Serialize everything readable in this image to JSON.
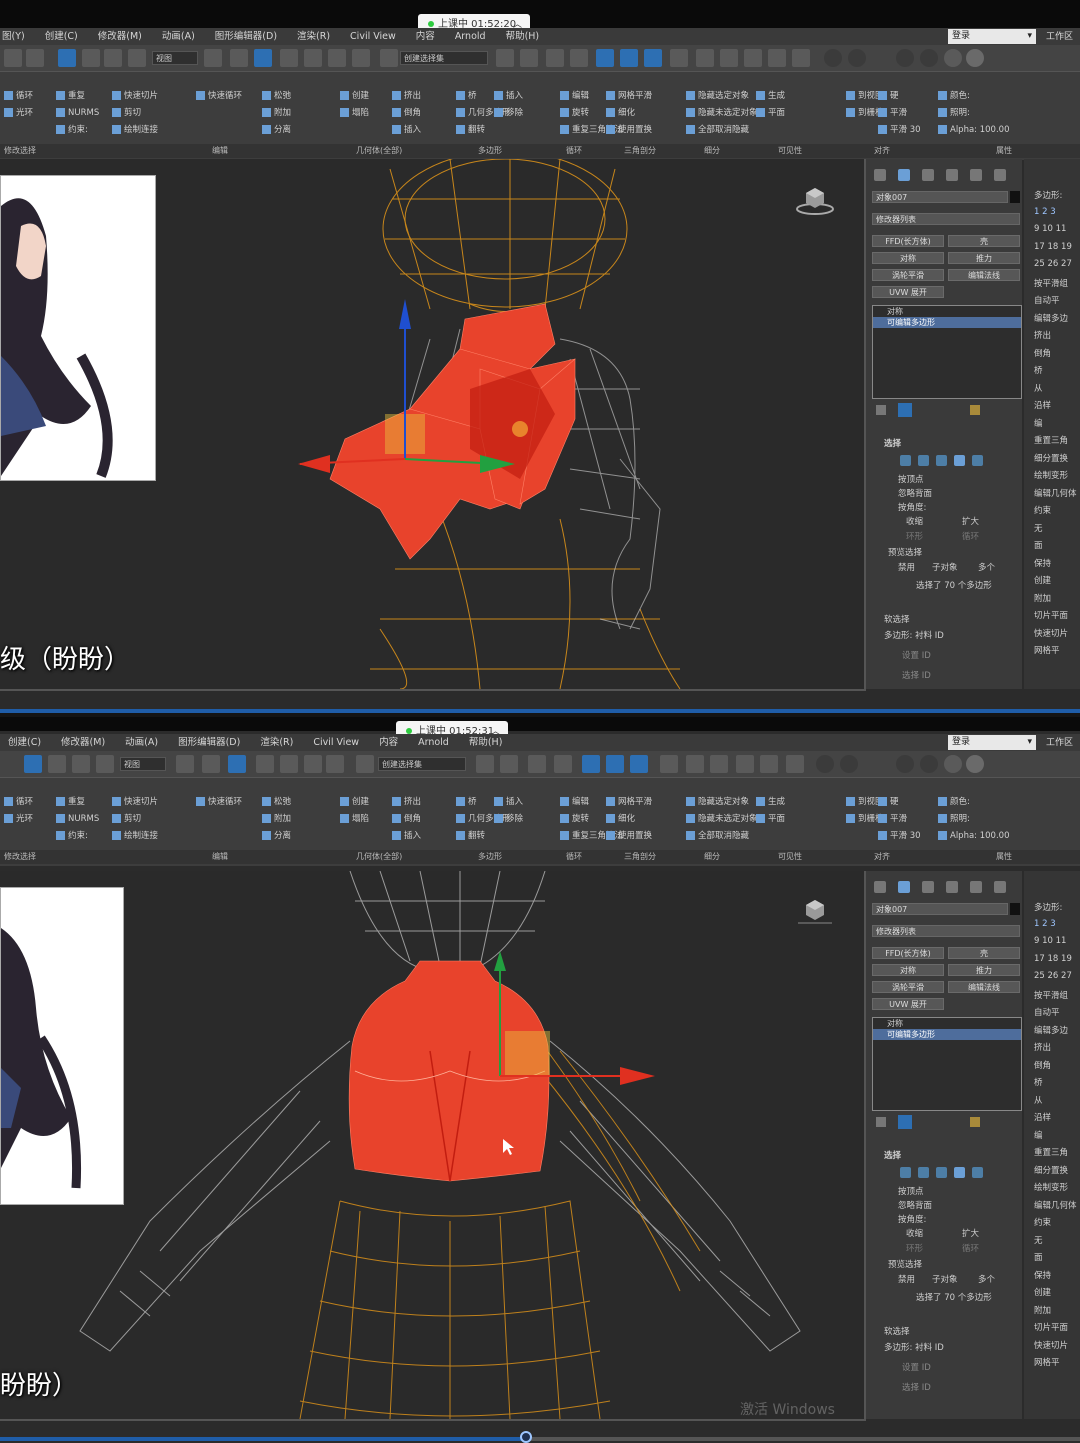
{
  "panels": [
    {
      "id": "shot1",
      "live_status": "上课中 01:52:20",
      "menu": [
        "图(Y)",
        "创建(C)",
        "修改器(M)",
        "动画(A)",
        "图形编辑器(D)",
        "渲染(R)",
        "Civil View",
        "内容",
        "Arnold",
        "帮助(H)"
      ],
      "login": "登录",
      "workspace": "工作区",
      "toolbar": {
        "view_dropdown": "视图",
        "selection_set": "创建选择集"
      },
      "ribbon_groups": [
        {
          "items": [
            "循环",
            "光环"
          ]
        },
        {
          "items": [
            "重复",
            "NURMS",
            "约束:"
          ]
        },
        {
          "items": [
            "快速切片",
            "剪切",
            "绘制连接"
          ]
        },
        {
          "items": [
            "快速循环"
          ]
        },
        {
          "items": [
            "松弛",
            "附加",
            "分离"
          ]
        },
        {
          "items": [
            "创建",
            "塌陷"
          ]
        },
        {
          "items": [
            "挤出",
            "倒角",
            "插入"
          ]
        },
        {
          "items": [
            "桥",
            "几何多边形",
            "翻转"
          ]
        },
        {
          "items": [
            "插入",
            "移除"
          ]
        },
        {
          "items": [
            "编辑",
            "旋转",
            "重复三角算法"
          ]
        },
        {
          "items": [
            "网格平滑",
            "细化",
            "使用置换"
          ]
        },
        {
          "items": [
            "隐藏选定对象",
            "隐藏未选定对象",
            "全部取消隐藏"
          ]
        },
        {
          "items": [
            "生成",
            "平面"
          ]
        },
        {
          "items": [
            "到视图",
            "到栅格"
          ]
        },
        {
          "items": [
            "硬",
            "平滑",
            "平滑 30"
          ]
        },
        {
          "items": [
            "颜色:",
            "照明:",
            "Alpha: 100.00"
          ]
        }
      ],
      "ribbon_footer": [
        "修改选择",
        "编辑",
        "几何体(全部)",
        "多边形",
        "循环",
        "三角剖分",
        "细分",
        "可见性",
        "对齐",
        "属性"
      ],
      "subtitle": "级（盼盼）",
      "command_panel": {
        "object_name": "对象007",
        "modifier_list": "修改器列表",
        "buttons": [
          "FFD(长方体)",
          "壳",
          "对称",
          "推力",
          "涡轮平滑",
          "编辑法线",
          "UVW 展开"
        ],
        "stack": [
          "对称",
          "可编辑多边形"
        ],
        "selection_title": "选择",
        "options": [
          "按顶点",
          "忽略背面",
          "按角度:",
          "收缩",
          "扩大",
          "环形",
          "循环",
          "预览选择",
          "禁用",
          "子对象",
          "多个"
        ],
        "status": "选择了 70 个多边形",
        "soft_title": "软选择",
        "soft_items": [
          "多边形: 衬料 ID",
          "设置 ID",
          "选择 ID"
        ]
      },
      "side_panel": [
        "多边形:",
        "1 2 3",
        "9 10 11",
        "17 18 19",
        "25 26 27",
        "按平滑组",
        "自动平",
        "编辑多边",
        "挤出",
        "倒角",
        "桥",
        "从",
        "沿样",
        "编",
        "重置三角",
        "细分置换",
        "绘制变形",
        "编辑几何体",
        "约束",
        "无",
        "面",
        "保持",
        "创建",
        "附加",
        "切片平面",
        "快速切片",
        "网格平"
      ]
    },
    {
      "id": "shot2",
      "live_status": "上课中 01:52:31",
      "menu": [
        "创建(C)",
        "修改器(M)",
        "动画(A)",
        "图形编辑器(D)",
        "渲染(R)",
        "Civil View",
        "内容",
        "Arnold",
        "帮助(H)"
      ],
      "login": "登录",
      "workspace": "工作区",
      "toolbar": {
        "view_dropdown": "视图",
        "selection_set": "创建选择集"
      },
      "subtitle": "盼盼）",
      "watermark": "激活 Windows",
      "command_panel": {
        "object_name": "对象007",
        "modifier_list": "修改器列表",
        "buttons": [
          "FFD(长方体)",
          "壳",
          "对称",
          "推力",
          "涡轮平滑",
          "编辑法线",
          "UVW 展开"
        ],
        "stack": [
          "对称",
          "可编辑多边形"
        ],
        "selection_title": "选择",
        "options": [
          "按顶点",
          "忽略背面",
          "按角度:",
          "收缩",
          "扩大",
          "环形",
          "循环",
          "预览选择",
          "禁用",
          "子对象",
          "多个"
        ],
        "status": "选择了 70 个多边形",
        "soft_title": "软选择",
        "soft_items": [
          "多边形: 衬料 ID",
          "设置 ID",
          "选择 ID"
        ]
      }
    }
  ],
  "colors": {
    "selected_faces": "#e8432c",
    "wire_orange": "#d8901a",
    "wire_white": "#e6e6e6",
    "accent_blue": "#2d6fb3"
  }
}
